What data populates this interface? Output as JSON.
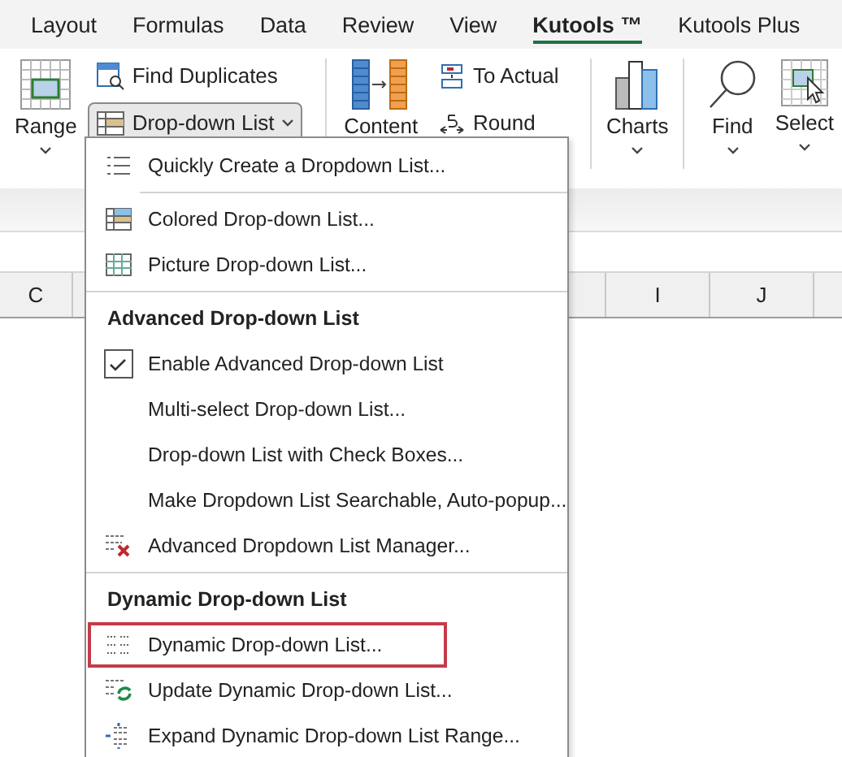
{
  "tabs": [
    {
      "label": "Layout",
      "selected": false
    },
    {
      "label": "Formulas",
      "selected": false
    },
    {
      "label": "Data",
      "selected": false
    },
    {
      "label": "Review",
      "selected": false
    },
    {
      "label": "View",
      "selected": false
    },
    {
      "label": "Kutools ™",
      "selected": true
    },
    {
      "label": "Kutools Plus",
      "selected": false
    }
  ],
  "ribbon": [
    {
      "kind": "large",
      "label": "Range",
      "caret": true
    },
    {
      "kind": "stack",
      "buttons": [
        {
          "label": "Find Duplicates",
          "caret": false,
          "open": false
        },
        {
          "label": "Drop-down List",
          "caret": true,
          "open": true
        }
      ]
    },
    {
      "kind": "separator"
    },
    {
      "kind": "large",
      "label": "Content",
      "caret": false
    },
    {
      "kind": "stack",
      "buttons": [
        {
          "label": "To Actual",
          "caret": false,
          "open": false
        },
        {
          "label": "Round",
          "caret": false,
          "open": false
        }
      ]
    },
    {
      "kind": "separator"
    },
    {
      "kind": "large",
      "label": "Charts",
      "caret": true
    },
    {
      "kind": "separator"
    },
    {
      "kind": "large",
      "label": "Find",
      "caret": true
    },
    {
      "kind": "large",
      "label": "Select",
      "caret": true
    }
  ],
  "columns": [
    {
      "label": "C"
    },
    {
      "label": "I"
    },
    {
      "label": "J"
    }
  ],
  "menu": [
    {
      "kind": "item",
      "label": "Quickly Create a Dropdown List...",
      "highlighted": false
    },
    {
      "kind": "separator"
    },
    {
      "kind": "item",
      "label": "Colored Drop-down List...",
      "highlighted": false
    },
    {
      "kind": "item",
      "label": "Picture Drop-down List...",
      "highlighted": false
    },
    {
      "kind": "separator"
    },
    {
      "kind": "header",
      "label": "Advanced Drop-down List"
    },
    {
      "kind": "check",
      "label": "Enable Advanced Drop-down List",
      "checked": true
    },
    {
      "kind": "item",
      "label": "Multi-select Drop-down List...",
      "highlighted": false
    },
    {
      "kind": "item",
      "label": "Drop-down List with Check Boxes...",
      "highlighted": false
    },
    {
      "kind": "item",
      "label": "Make Dropdown List Searchable, Auto-popup...",
      "highlighted": false
    },
    {
      "kind": "item",
      "label": "Advanced Dropdown List Manager...",
      "highlighted": false
    },
    {
      "kind": "separator"
    },
    {
      "kind": "header",
      "label": "Dynamic Drop-down List"
    },
    {
      "kind": "item",
      "label": "Dynamic Drop-down List...",
      "highlighted": true
    },
    {
      "kind": "item",
      "label": "Update Dynamic Drop-down List...",
      "highlighted": false
    },
    {
      "kind": "item",
      "label": "Expand Dynamic Drop-down List Range...",
      "highlighted": false
    }
  ]
}
